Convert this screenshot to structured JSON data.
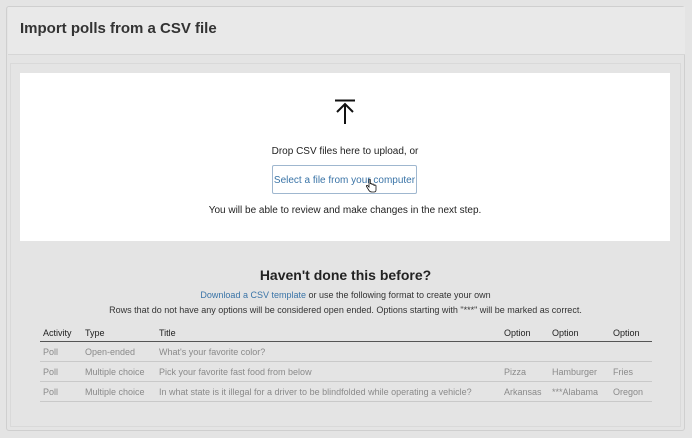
{
  "page_title": "Import polls from a CSV file",
  "dropzone": {
    "icon": "upload-arrow-icon",
    "drop_text": "Drop CSV files here to upload, or",
    "select_button_label": "Select a file from your computer",
    "review_text": "You will be able to review and make changes in the next step."
  },
  "help": {
    "heading": "Haven't done this before?",
    "template_link": "Download a CSV template",
    "line1_rest": " or use the following format to create your own",
    "line2": "Rows that do not have any options will be considered open ended. Options starting with \"***\" will be marked as correct."
  },
  "table": {
    "headers": [
      "Activity",
      "Type",
      "Title",
      "Option",
      "Option",
      "Option"
    ],
    "rows": [
      [
        "Poll",
        "Open-ended",
        "What's your favorite color?",
        "",
        "",
        ""
      ],
      [
        "Poll",
        "Multiple choice",
        "Pick your favorite fast food from below",
        "Pizza",
        "Hamburger",
        "Fries"
      ],
      [
        "Poll",
        "Multiple choice",
        "In what state is it illegal for a driver to be blindfolded while operating a vehicle?",
        "Arkansas",
        "***Alabama",
        "Oregon"
      ]
    ]
  },
  "colors": {
    "link": "#3a74a7",
    "background": "#e4e4e4",
    "panel": "#ffffff"
  }
}
